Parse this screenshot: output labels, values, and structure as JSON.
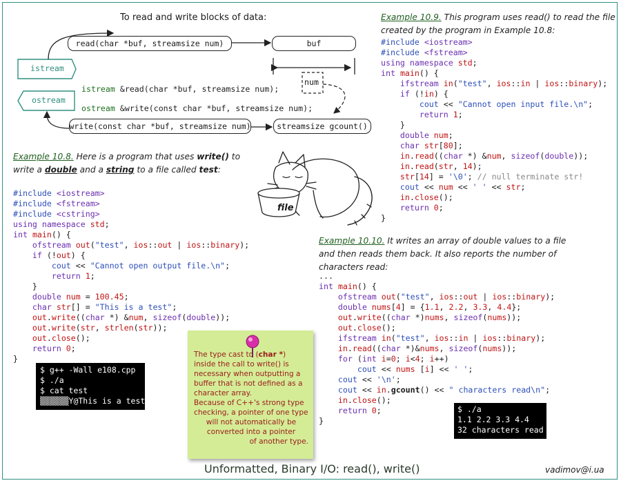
{
  "diagram": {
    "title": "To read and write blocks of data:",
    "read_sig": "read(char *buf, streamsize num)",
    "buf_label": "buf",
    "istream_label": "istream",
    "ostream_label": "ostream",
    "num_label": "num",
    "write_sig": "write(const char *buf, streamsize num)",
    "gcount_sig": "streamsize gcount()",
    "decl_read_type": "istream",
    "decl_read_rest": "&read(char *buf, streamsize num);",
    "decl_write_type": "ostream",
    "decl_write_rest": "&write(const char *buf, streamsize num);"
  },
  "example_10_8": {
    "label": "Example 10.8.",
    "l1_pre": " Here is a program that uses ",
    "l1_kw": "write()",
    "l1_post": " to",
    "l2_pre": "write a ",
    "l2_kw1": "double",
    "l2_mid": " and a ",
    "l2_kw2": "string",
    "l2_mid2": " to a  file called ",
    "l2_kw3": "test",
    "l2_post": ":"
  },
  "example_10_9": {
    "label": "Example 10.9.",
    "l1": " This program uses read() to read the file",
    "l2": "created by the program in Example 10.8:"
  },
  "example_10_10": {
    "label": "Example 10.10.",
    "l1": " It writes an array of double values to a file",
    "l2": "and then reads them back. It also reports the number of",
    "l3": "characters read:"
  },
  "terminal_1": {
    "lines": [
      "$ g++ -Wall e108.cpp",
      "$ ./a",
      "$ cat test",
      "▒▒▒▒▒▒Y@This is a test"
    ]
  },
  "terminal_2": {
    "lines": [
      "$ ./a",
      "1.1 2.2 3.3 4.4",
      "32 characters read"
    ]
  },
  "sticky_note": {
    "p1_pre": "The type cast to (",
    "p1_kw": "char *",
    "p1_post": ") inside the call to write() is necessary when outputting a buffer that is not defined as a character array.",
    "p2_a": "Because of C++'s strong type checking, a pointer of one type",
    "p2_b": "will not automatically be",
    "p2_c": "converted into a pointer",
    "p2_d": "of another type."
  },
  "cat_label": "file",
  "footer": {
    "title": "Unformatted, Binary I/O: read(), write()",
    "author": "vadimov@i.ua"
  },
  "colors": {
    "keyword": "#6b2fb0",
    "identifier": "#c01313",
    "string": "#2d4fb8",
    "heading_green": "#1f5f1f",
    "note_background": "#d4ec96",
    "border": "#2f8f7f"
  }
}
